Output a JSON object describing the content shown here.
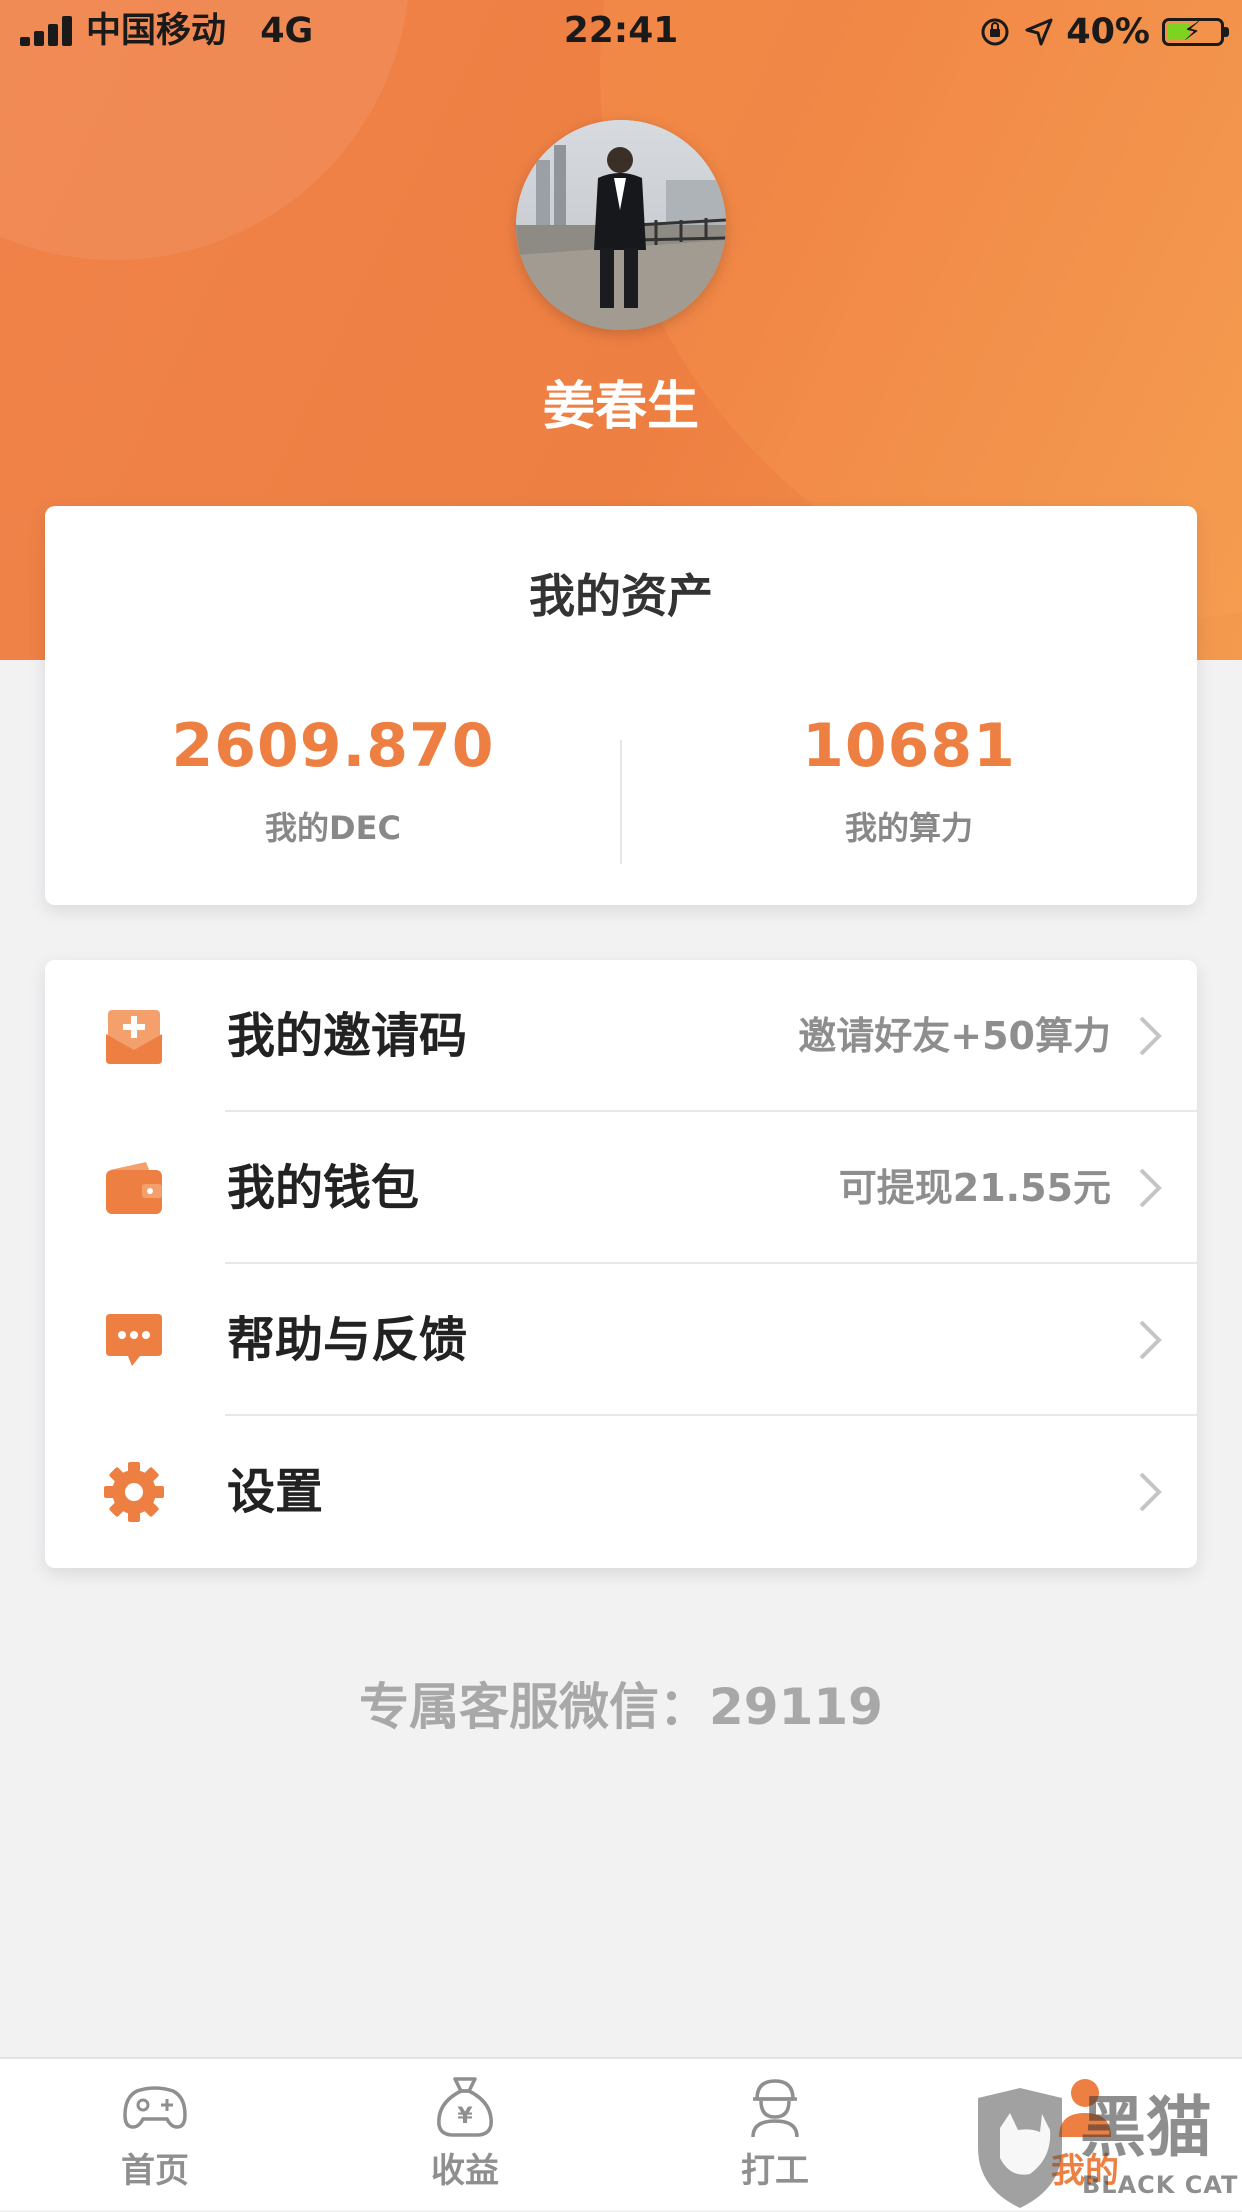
{
  "status_bar": {
    "carrier": "中国移动",
    "network": "4G",
    "time": "22:41",
    "battery_percent": "40%"
  },
  "profile": {
    "name": "姜春生"
  },
  "assets": {
    "title": "我的资产",
    "dec_value": "2609.870",
    "dec_label": "我的DEC",
    "power_value": "10681",
    "power_label": "我的算力"
  },
  "menu": {
    "items": [
      {
        "label": "我的邀请码",
        "hint": "邀请好友+50算力",
        "icon": "invite-envelope-icon"
      },
      {
        "label": "我的钱包",
        "hint": "可提现21.55元",
        "icon": "wallet-icon"
      },
      {
        "label": "帮助与反馈",
        "hint": "",
        "icon": "chat-bubble-icon"
      },
      {
        "label": "设置",
        "hint": "",
        "icon": "gear-icon"
      }
    ]
  },
  "service": {
    "text": "专属客服微信：29119"
  },
  "tabbar": {
    "tabs": [
      {
        "label": "首页",
        "icon": "gamepad-icon"
      },
      {
        "label": "收益",
        "icon": "money-bag-icon"
      },
      {
        "label": "打工",
        "icon": "worker-icon"
      },
      {
        "label": "我的",
        "icon": "person-icon",
        "active": true
      }
    ]
  },
  "watermark": {
    "cn": "黑猫",
    "en": "BLACK CAT"
  },
  "colors": {
    "accent": "#ee7f42",
    "text_muted": "#8e8e8e",
    "background": "#f2f2f3"
  }
}
